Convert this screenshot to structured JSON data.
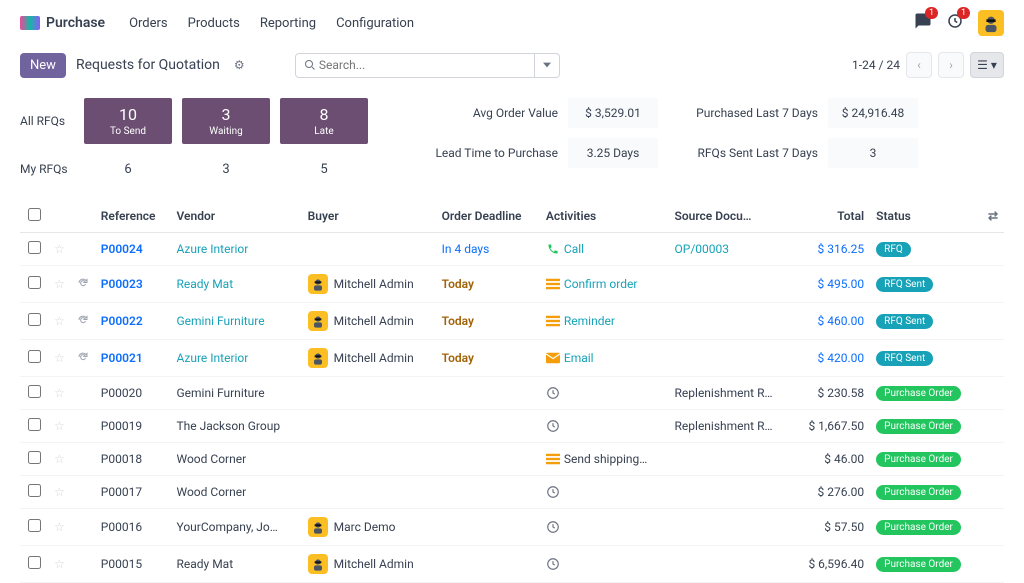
{
  "brand": "Purchase",
  "nav": {
    "orders": "Orders",
    "products": "Products",
    "reporting": "Reporting",
    "configuration": "Configuration"
  },
  "notifications": {
    "chat_badge": "1",
    "activity_badge": "1"
  },
  "actions": {
    "new": "New",
    "title": "Requests for Quotation"
  },
  "search": {
    "placeholder": "Search..."
  },
  "pagination": {
    "range": "1-24 / 24"
  },
  "stats_labels": {
    "all": "All RFQs",
    "my": "My RFQs"
  },
  "stats_all": {
    "to_send": {
      "num": "10",
      "lbl": "To Send"
    },
    "waiting": {
      "num": "3",
      "lbl": "Waiting"
    },
    "late": {
      "num": "8",
      "lbl": "Late"
    }
  },
  "stats_my": {
    "to_send": "6",
    "waiting": "3",
    "late": "5"
  },
  "kpi": {
    "avg_lbl": "Avg Order Value",
    "avg_val": "$ 3,529.01",
    "purch_lbl": "Purchased Last 7 Days",
    "purch_val": "$ 24,916.48",
    "lead_lbl": "Lead Time to Purchase",
    "lead_val": "3.25 Days",
    "sent_lbl": "RFQs Sent Last 7 Days",
    "sent_val": "3"
  },
  "headers": {
    "reference": "Reference",
    "vendor": "Vendor",
    "buyer": "Buyer",
    "deadline": "Order Deadline",
    "activities": "Activities",
    "source": "Source Docu…",
    "total": "Total",
    "status": "Status"
  },
  "rows": [
    {
      "ref": "P00024",
      "ref_link": true,
      "vendor": "Azure Interior",
      "vendor_link": true,
      "buyer": "",
      "deadline": "In 4 days",
      "deadline_style": "blue",
      "activity_icon": "phone",
      "activity_text": "Call",
      "activity_link": true,
      "source": "OP/00003",
      "source_link": true,
      "total": "$ 316.25",
      "total_link": true,
      "status": "RFQ",
      "status_class": "status-rfq"
    },
    {
      "ref": "P00023",
      "ref_link": true,
      "vendor": "Ready Mat",
      "vendor_link": true,
      "buyer": "Mitchell Admin",
      "deadline": "Today",
      "deadline_style": "today",
      "activity_icon": "list",
      "activity_text": "Confirm order",
      "activity_link": true,
      "source": "",
      "total": "$ 495.00",
      "total_link": true,
      "status": "RFQ Sent",
      "status_class": "status-rfqsent",
      "resend": true
    },
    {
      "ref": "P00022",
      "ref_link": true,
      "vendor": "Gemini Furniture",
      "vendor_link": true,
      "buyer": "Mitchell Admin",
      "deadline": "Today",
      "deadline_style": "today",
      "activity_icon": "list",
      "activity_text": "Reminder",
      "activity_link": true,
      "source": "",
      "total": "$ 460.00",
      "total_link": true,
      "status": "RFQ Sent",
      "status_class": "status-rfqsent",
      "resend": true
    },
    {
      "ref": "P00021",
      "ref_link": true,
      "vendor": "Azure Interior",
      "vendor_link": true,
      "buyer": "Mitchell Admin",
      "deadline": "Today",
      "deadline_style": "today",
      "activity_icon": "mail",
      "activity_text": "Email",
      "activity_link": true,
      "source": "",
      "total": "$ 420.00",
      "total_link": true,
      "status": "RFQ Sent",
      "status_class": "status-rfqsent",
      "resend": true
    },
    {
      "ref": "P00020",
      "vendor": "Gemini Furniture",
      "buyer": "",
      "deadline": "",
      "activity_icon": "clock",
      "activity_text": "",
      "source": "Replenishment R…",
      "total": "$ 230.58",
      "status": "Purchase Order",
      "status_class": "status-po"
    },
    {
      "ref": "P00019",
      "vendor": "The Jackson Group",
      "buyer": "",
      "deadline": "",
      "activity_icon": "clock",
      "activity_text": "",
      "source": "Replenishment R…",
      "total": "$ 1,667.50",
      "status": "Purchase Order",
      "status_class": "status-po"
    },
    {
      "ref": "P00018",
      "vendor": "Wood Corner",
      "buyer": "",
      "deadline": "",
      "activity_icon": "list",
      "activity_text": "Send shipping…",
      "source": "",
      "total": "$ 46.00",
      "status": "Purchase Order",
      "status_class": "status-po"
    },
    {
      "ref": "P00017",
      "vendor": "Wood Corner",
      "buyer": "",
      "deadline": "",
      "activity_icon": "clock",
      "activity_text": "",
      "source": "",
      "total": "$ 276.00",
      "status": "Purchase Order",
      "status_class": "status-po"
    },
    {
      "ref": "P00016",
      "vendor": "YourCompany, Jo…",
      "buyer": "Marc Demo",
      "deadline": "",
      "activity_icon": "clock",
      "activity_text": "",
      "source": "",
      "total": "$ 57.50",
      "status": "Purchase Order",
      "status_class": "status-po"
    },
    {
      "ref": "P00015",
      "vendor": "Ready Mat",
      "buyer": "Mitchell Admin",
      "deadline": "",
      "activity_icon": "clock",
      "activity_text": "",
      "source": "",
      "total": "$ 6,596.40",
      "status": "Purchase Order",
      "status_class": "status-po"
    }
  ]
}
